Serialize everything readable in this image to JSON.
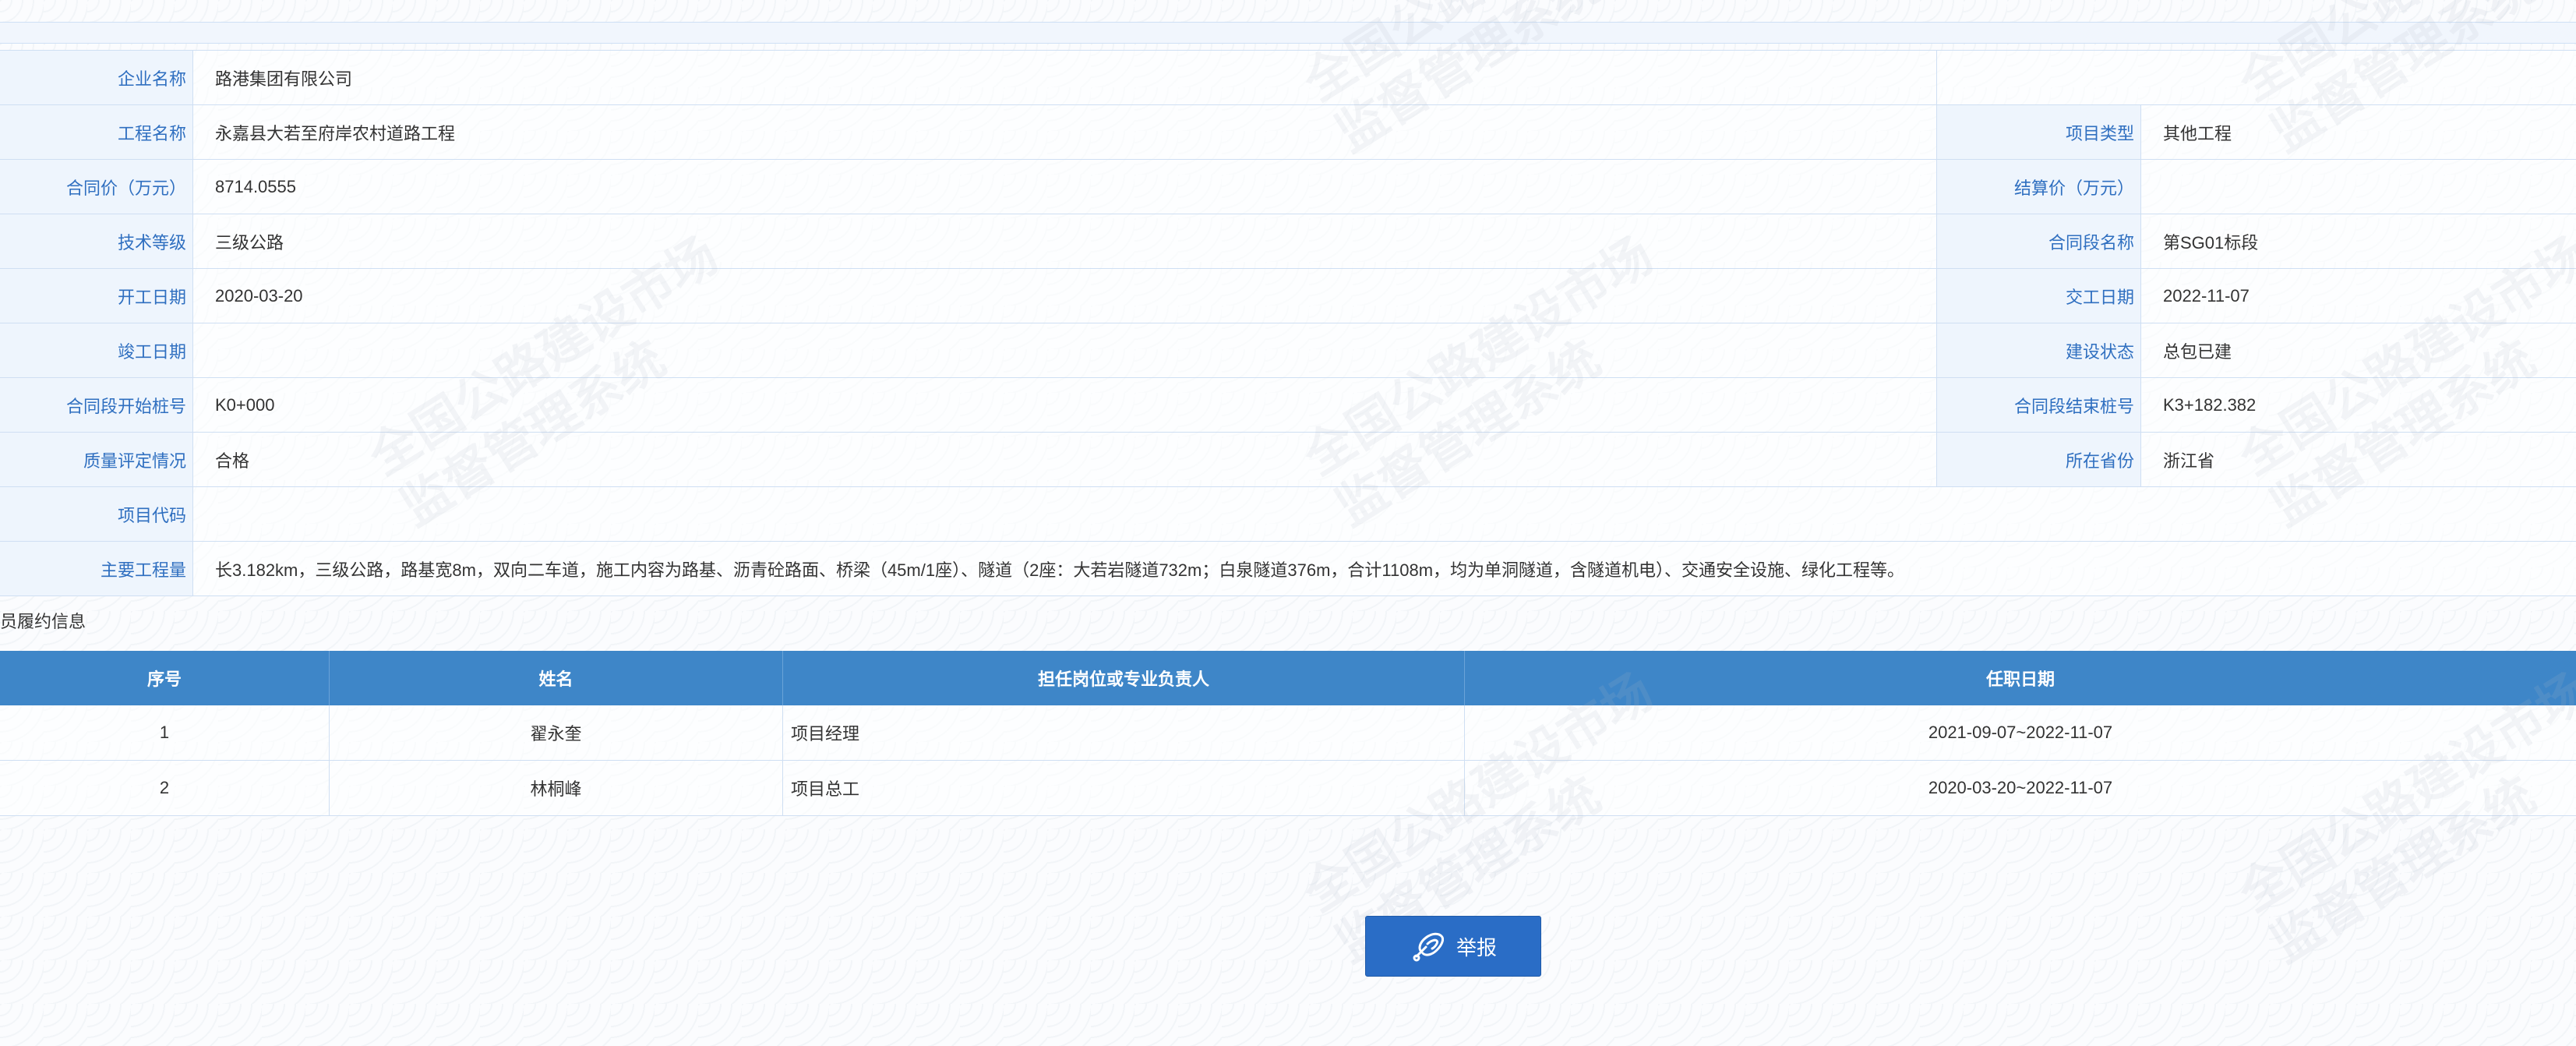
{
  "project_info": {
    "rows": [
      {
        "label": "企业名称",
        "value": "路港集团有限公司"
      },
      {
        "label": "工程名称",
        "value": "永嘉县大若至府岸农村道路工程",
        "right_label": "项目类型",
        "right_value": "其他工程"
      },
      {
        "label": "合同价（万元）",
        "value": "8714.0555",
        "right_label": "结算价（万元）",
        "right_value": ""
      },
      {
        "label": "技术等级",
        "value": "三级公路",
        "right_label": "合同段名称",
        "right_value": "第SG01标段"
      },
      {
        "label": "开工日期",
        "value": "2020-03-20",
        "right_label": "交工日期",
        "right_value": "2022-11-07"
      },
      {
        "label": "竣工日期",
        "value": "",
        "right_label": "建设状态",
        "right_value": "总包已建"
      },
      {
        "label": "合同段开始桩号",
        "value": "K0+000",
        "right_label": "合同段结束桩号",
        "right_value": "K3+182.382"
      },
      {
        "label": "质量评定情况",
        "value": "合格",
        "right_label": "所在省份",
        "right_value": "浙江省"
      },
      {
        "label": "项目代码",
        "value": ""
      },
      {
        "label": "主要工程量",
        "value": "长3.182km，三级公路，路基宽8m，双向二车道，施工内容为路基、沥青砼路面、桥梁（45m/1座）、隧道（2座：大若岩隧道732m；白泉隧道376m，合计1108m，均为单洞隧道，含隧道机电）、交通安全设施、绿化工程等。"
      }
    ]
  },
  "personnel": {
    "section_title": "人员履约信息",
    "headers": [
      "序号",
      "姓名",
      "担任岗位或专业负责人",
      "任职日期"
    ],
    "rows": [
      {
        "no": "1",
        "name": "翟永奎",
        "position": "项目经理",
        "dates": "2021-09-07~2022-11-07"
      },
      {
        "no": "2",
        "name": "林桐峰",
        "position": "项目总工",
        "dates": "2020-03-20~2022-11-07"
      }
    ]
  },
  "report_button": {
    "label": "举报",
    "icon": "megaphone-icon"
  },
  "watermark": {
    "line1": "全国公路建设市场",
    "line2": "监督管理系统"
  },
  "colors": {
    "label_text": "#2f6fc0",
    "label_bg": "#eef5fd",
    "header_bg": "#3e86c8",
    "button_bg": "#2a6dc6",
    "border": "#cfdff3"
  }
}
